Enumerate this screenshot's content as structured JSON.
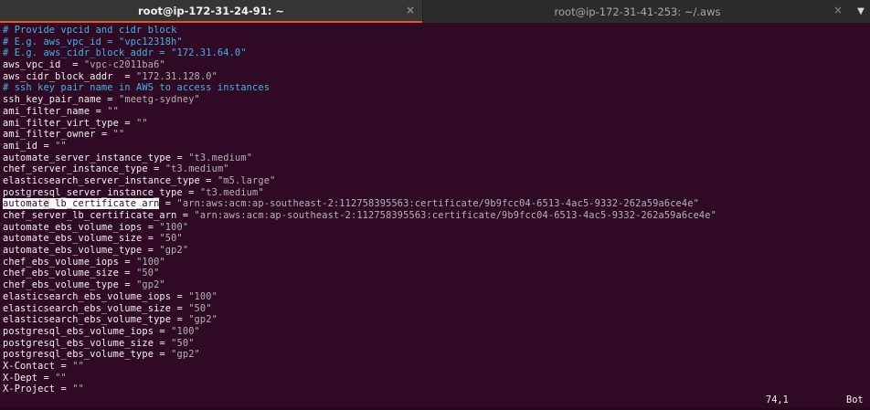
{
  "tabs": [
    {
      "title": "root@ip-172-31-24-91: ~",
      "close": "×"
    },
    {
      "title": "root@ip-172-31-41-253: ~/.aws",
      "close": "×"
    }
  ],
  "tabs_menu": "▼",
  "editor": {
    "lines": [
      {
        "type": "comment",
        "text": "# Provide vpcid and cidr block"
      },
      {
        "type": "comment",
        "text": "# E.g. aws_vpc_id = \"vpc12318h\""
      },
      {
        "type": "comment",
        "text": "# E.g. aws_cidr_block_addr = \"172.31.64.0\""
      },
      {
        "type": "kv",
        "key": "aws_vpc_id",
        "op": "  = ",
        "value": "\"vpc-c2011ba6\""
      },
      {
        "type": "kv",
        "key": "aws_cidr_block_addr",
        "op": "  = ",
        "value": "\"172.31.128.0\""
      },
      {
        "type": "comment",
        "text": "# ssh key pair name in AWS to access instances"
      },
      {
        "type": "kv",
        "key": "ssh_key_pair_name",
        "op": " = ",
        "value": "\"meetg-sydney\""
      },
      {
        "type": "kv",
        "key": "ami_filter_name",
        "op": " = ",
        "value": "\"\""
      },
      {
        "type": "kv",
        "key": "ami_filter_virt_type",
        "op": " = ",
        "value": "\"\""
      },
      {
        "type": "kv",
        "key": "ami_filter_owner",
        "op": " = ",
        "value": "\"\""
      },
      {
        "type": "kv",
        "key": "ami_id",
        "op": " = ",
        "value": "\"\""
      },
      {
        "type": "kv",
        "key": "automate_server_instance_type",
        "op": " = ",
        "value": "\"t3.medium\""
      },
      {
        "type": "kv",
        "key": "chef_server_instance_type",
        "op": " = ",
        "value": "\"t3.medium\""
      },
      {
        "type": "kv",
        "key": "elasticsearch_server_instance_type",
        "op": " = ",
        "value": "\"m5.large\""
      },
      {
        "type": "kv",
        "key": "postgresql_server_instance_type",
        "op": " = ",
        "value": "\"t3.medium\""
      },
      {
        "type": "kv_selected",
        "key_a": "automat",
        "cursor": "e",
        "key_b": "_lb_certificate_arn",
        "op": " = ",
        "value": "\"arn:aws:acm:ap-southeast-2:112758395563:certificate/9b9fcc04-6513-4ac5-9332-262a59a6ce4e\""
      },
      {
        "type": "kv",
        "key": "chef_server_lb_certificate_arn",
        "op": " = ",
        "value": "\"arn:aws:acm:ap-southeast-2:112758395563:certificate/9b9fcc04-6513-4ac5-9332-262a59a6ce4e\""
      },
      {
        "type": "kv",
        "key": "automate_ebs_volume_iops",
        "op": " = ",
        "value": "\"100\""
      },
      {
        "type": "kv",
        "key": "automate_ebs_volume_size",
        "op": " = ",
        "value": "\"50\""
      },
      {
        "type": "kv",
        "key": "automate_ebs_volume_type",
        "op": " = ",
        "value": "\"gp2\""
      },
      {
        "type": "kv",
        "key": "chef_ebs_volume_iops",
        "op": " = ",
        "value": "\"100\""
      },
      {
        "type": "kv",
        "key": "chef_ebs_volume_size",
        "op": " = ",
        "value": "\"50\""
      },
      {
        "type": "kv",
        "key": "chef_ebs_volume_type",
        "op": " = ",
        "value": "\"gp2\""
      },
      {
        "type": "kv",
        "key": "elasticsearch_ebs_volume_iops",
        "op": " = ",
        "value": "\"100\""
      },
      {
        "type": "kv",
        "key": "elasticsearch_ebs_volume_size",
        "op": " = ",
        "value": "\"50\""
      },
      {
        "type": "kv",
        "key": "elasticsearch_ebs_volume_type",
        "op": " = ",
        "value": "\"gp2\""
      },
      {
        "type": "kv",
        "key": "postgresql_ebs_volume_iops",
        "op": " = ",
        "value": "\"100\""
      },
      {
        "type": "kv",
        "key": "postgresql_ebs_volume_size",
        "op": " = ",
        "value": "\"50\""
      },
      {
        "type": "kv",
        "key": "postgresql_ebs_volume_type",
        "op": " = ",
        "value": "\"gp2\""
      },
      {
        "type": "kv",
        "key": "X-Contact",
        "op": " = ",
        "value": "\"\""
      },
      {
        "type": "kv",
        "key": "X-Dept",
        "op": " = ",
        "value": "\"\""
      },
      {
        "type": "kv",
        "key": "X-Project",
        "op": " = ",
        "value": "\"\""
      }
    ]
  },
  "status": {
    "position": "74,1",
    "scroll": "Bot"
  },
  "colors": {
    "background": "#300a24",
    "comment": "#40b4e6",
    "string": "#b3b3b3",
    "tab_accent": "#e95420"
  }
}
